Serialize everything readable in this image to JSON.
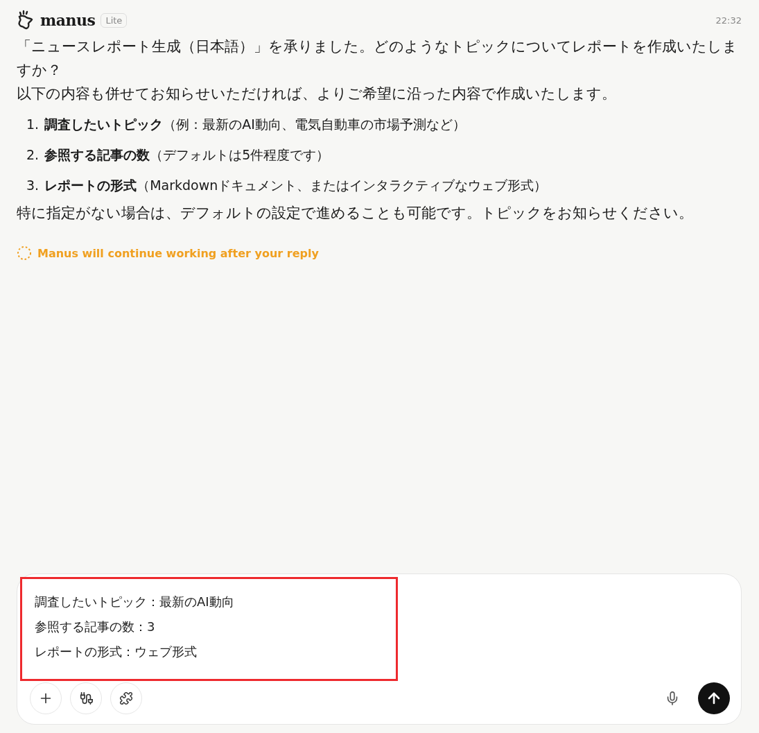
{
  "header": {
    "brand": "manus",
    "badge": "Lite",
    "time": "22:32"
  },
  "message": {
    "intro": "「ニュースレポート生成（日本語）」を承りました。どのようなトピックについてレポートを作成いたしますか？",
    "lead": "以下の内容も併せてお知らせいただければ、よりご希望に沿った内容で作成いたします。",
    "items": [
      {
        "marker": "1.",
        "text": "**調査したいトピック**（例：最新のAI動向、電気自動車の市場予測など）"
      },
      {
        "marker": "2.",
        "text": "**参照する記事の数**（デフォルトは5件程度です）"
      },
      {
        "marker": "3.",
        "text": "**レポートの形式**（Markdownドキュメント、またはインタラクティブなウェブ形式）"
      }
    ],
    "closing": "特に指定がない場合は、デフォルトの設定で進めることも可能です。トピックをお知らせください。"
  },
  "status": "Manus will continue working after your reply",
  "composer": {
    "highlighted": true,
    "lines": [
      "調査したいトピック：最新のAI動向",
      "参照する記事の数：3",
      "レポートの形式：ウェブ形式"
    ]
  }
}
